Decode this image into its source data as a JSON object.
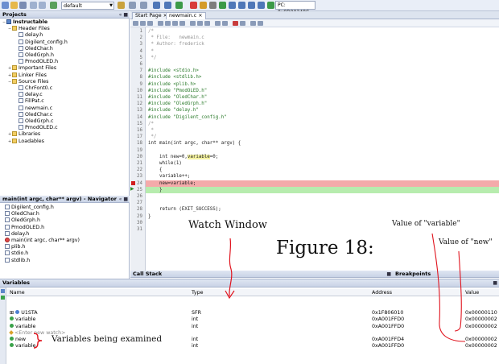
{
  "toolbar": {
    "config_select": "default",
    "pc_label": "PC: 0x9D00248C"
  },
  "tabs": [
    {
      "label": "Start Page"
    },
    {
      "label": "newmain.c"
    }
  ],
  "projects": {
    "title": "Projects",
    "controls": "« ■",
    "tree": [
      {
        "label": "Instructable",
        "kind": "proj",
        "toggle": "−",
        "bold": true
      },
      {
        "label": "Header Files",
        "kind": "folder",
        "toggle": "−"
      },
      {
        "label": "delay.h",
        "kind": "file",
        "toggle": ""
      },
      {
        "label": "Digilent_config.h",
        "kind": "file",
        "toggle": ""
      },
      {
        "label": "OledChar.h",
        "kind": "file",
        "toggle": ""
      },
      {
        "label": "OledGrph.h",
        "kind": "file",
        "toggle": ""
      },
      {
        "label": "PmodOLED.h",
        "kind": "file",
        "toggle": ""
      },
      {
        "label": "Important Files",
        "kind": "folder",
        "toggle": "+"
      },
      {
        "label": "Linker Files",
        "kind": "folder",
        "toggle": "+"
      },
      {
        "label": "Source Files",
        "kind": "folder",
        "toggle": "−"
      },
      {
        "label": "ChrFont0.c",
        "kind": "file",
        "toggle": ""
      },
      {
        "label": "delay.c",
        "kind": "file",
        "toggle": ""
      },
      {
        "label": "FillPat.c",
        "kind": "file",
        "toggle": ""
      },
      {
        "label": "newmain.c",
        "kind": "file",
        "toggle": ""
      },
      {
        "label": "OledChar.c",
        "kind": "file",
        "toggle": ""
      },
      {
        "label": "OledGrph.c",
        "kind": "file",
        "toggle": ""
      },
      {
        "label": "PmodOLED.c",
        "kind": "file",
        "toggle": ""
      },
      {
        "label": "Libraries",
        "kind": "folder",
        "toggle": "+"
      },
      {
        "label": "Loadables",
        "kind": "folder",
        "toggle": "+"
      }
    ]
  },
  "navigator": {
    "title": "main(int argc, char** argv) - Navigator",
    "controls": "« ■",
    "items": [
      {
        "label": "Digilent_config.h",
        "kind": "file"
      },
      {
        "label": "OledChar.h",
        "kind": "file"
      },
      {
        "label": "OledGrph.h",
        "kind": "file"
      },
      {
        "label": "PmodOLED.h",
        "kind": "file"
      },
      {
        "label": "delay.h",
        "kind": "file"
      },
      {
        "label": "main(int argc, char** argv)",
        "kind": "func"
      },
      {
        "label": "plib.h",
        "kind": "file"
      },
      {
        "label": "stdio.h",
        "kind": "file"
      },
      {
        "label": "stdlib.h",
        "kind": "file"
      }
    ]
  },
  "editor": {
    "line_numbers": [
      "1",
      "2",
      "3",
      "4",
      "5",
      "6",
      "7",
      "8",
      "9",
      "10",
      "11",
      "12",
      "13",
      "14",
      "15",
      "16",
      "17",
      "18",
      "19",
      "20",
      "21",
      "22",
      "23",
      "24",
      "25",
      "26",
      "27",
      "28",
      "29",
      "30",
      "31"
    ],
    "lines": [
      {
        "text": "/*",
        "cls": "c-comment"
      },
      {
        "text": " * File:   newmain.c",
        "cls": "c-comment"
      },
      {
        "text": " * Author: frederick",
        "cls": "c-comment"
      },
      {
        "text": " *",
        "cls": "c-comment"
      },
      {
        "text": " */",
        "cls": "c-comment"
      },
      {
        "text": "",
        "cls": ""
      },
      {
        "text": "#include <stdio.h>",
        "cls": "c-pre"
      },
      {
        "text": "#include <stdlib.h>",
        "cls": "c-pre"
      },
      {
        "text": "#include <plib.h>",
        "cls": "c-pre"
      },
      {
        "text": "#include \"PmodOLED.h\"",
        "cls": "c-pre"
      },
      {
        "text": "#include \"OledChar.h\"",
        "cls": "c-pre"
      },
      {
        "text": "#include \"OledGrph.h\"",
        "cls": "c-pre"
      },
      {
        "text": "#include \"delay.h\"",
        "cls": "c-pre"
      },
      {
        "text": "#include \"Digilent_config.h\"",
        "cls": "c-pre"
      },
      {
        "text": "/*",
        "cls": "c-comment"
      },
      {
        "text": " *",
        "cls": "c-comment"
      },
      {
        "text": " */",
        "cls": "c-comment"
      },
      {
        "text": "int main(int argc, char** argv) {",
        "cls": ""
      },
      {
        "text": "",
        "cls": ""
      },
      {
        "text": "    int new=0,variable=0;",
        "cls": ""
      },
      {
        "text": "    while(1)",
        "cls": ""
      },
      {
        "text": "    {",
        "cls": ""
      },
      {
        "text": "    variable++;",
        "cls": ""
      },
      {
        "text": "    new=variable;",
        "cls": ""
      },
      {
        "text": "    }",
        "cls": ""
      },
      {
        "text": "",
        "cls": ""
      },
      {
        "text": "",
        "cls": ""
      },
      {
        "text": "    return (EXIT_SUCCESS);",
        "cls": ""
      },
      {
        "text": "}",
        "cls": ""
      },
      {
        "text": "",
        "cls": ""
      },
      {
        "text": "",
        "cls": ""
      }
    ]
  },
  "callstack": {
    "title": "Call Stack",
    "controls": "■"
  },
  "breakpoints": {
    "title": "Breakpoints"
  },
  "variables": {
    "title": "Variables",
    "controls": "■",
    "columns": {
      "name": "Name",
      "type": "Type",
      "address": "Address",
      "value": "Value"
    },
    "rows": [
      {
        "name": "U1STA",
        "type": "SFR",
        "address": "0x1F806010",
        "value": "0x00000110",
        "icon": "blue",
        "indent": "⊞ "
      },
      {
        "name": "variable",
        "type": "int",
        "address": "0xA001FFD0",
        "value": "0x00000002",
        "icon": "green",
        "indent": ""
      },
      {
        "name": "variable",
        "type": "int",
        "address": "0xA001FFD0",
        "value": "0x00000002",
        "icon": "green",
        "indent": ""
      },
      {
        "name": "<Enter new watch>",
        "type": "",
        "address": "",
        "value": "",
        "icon": "diamond",
        "indent": ""
      },
      {
        "name": "new",
        "type": "int",
        "address": "0xA001FFD4",
        "value": "0x00000002",
        "icon": "green",
        "indent": ""
      },
      {
        "name": "variable",
        "type": "int",
        "address": "0xA001FFD0",
        "value": "0x00000002",
        "icon": "green",
        "indent": ""
      }
    ]
  },
  "annotations": {
    "watch_window": "Watch Window",
    "figure": "Figure 18:",
    "value_variable": "Value of \"variable\"",
    "value_new": "Value of \"new\"",
    "vars_examined": "Variables being examined"
  },
  "colors": {
    "breakpoint_line": "#f4aaaa",
    "current_line": "#b7ecae",
    "annotation_ink": "#e0141e"
  }
}
